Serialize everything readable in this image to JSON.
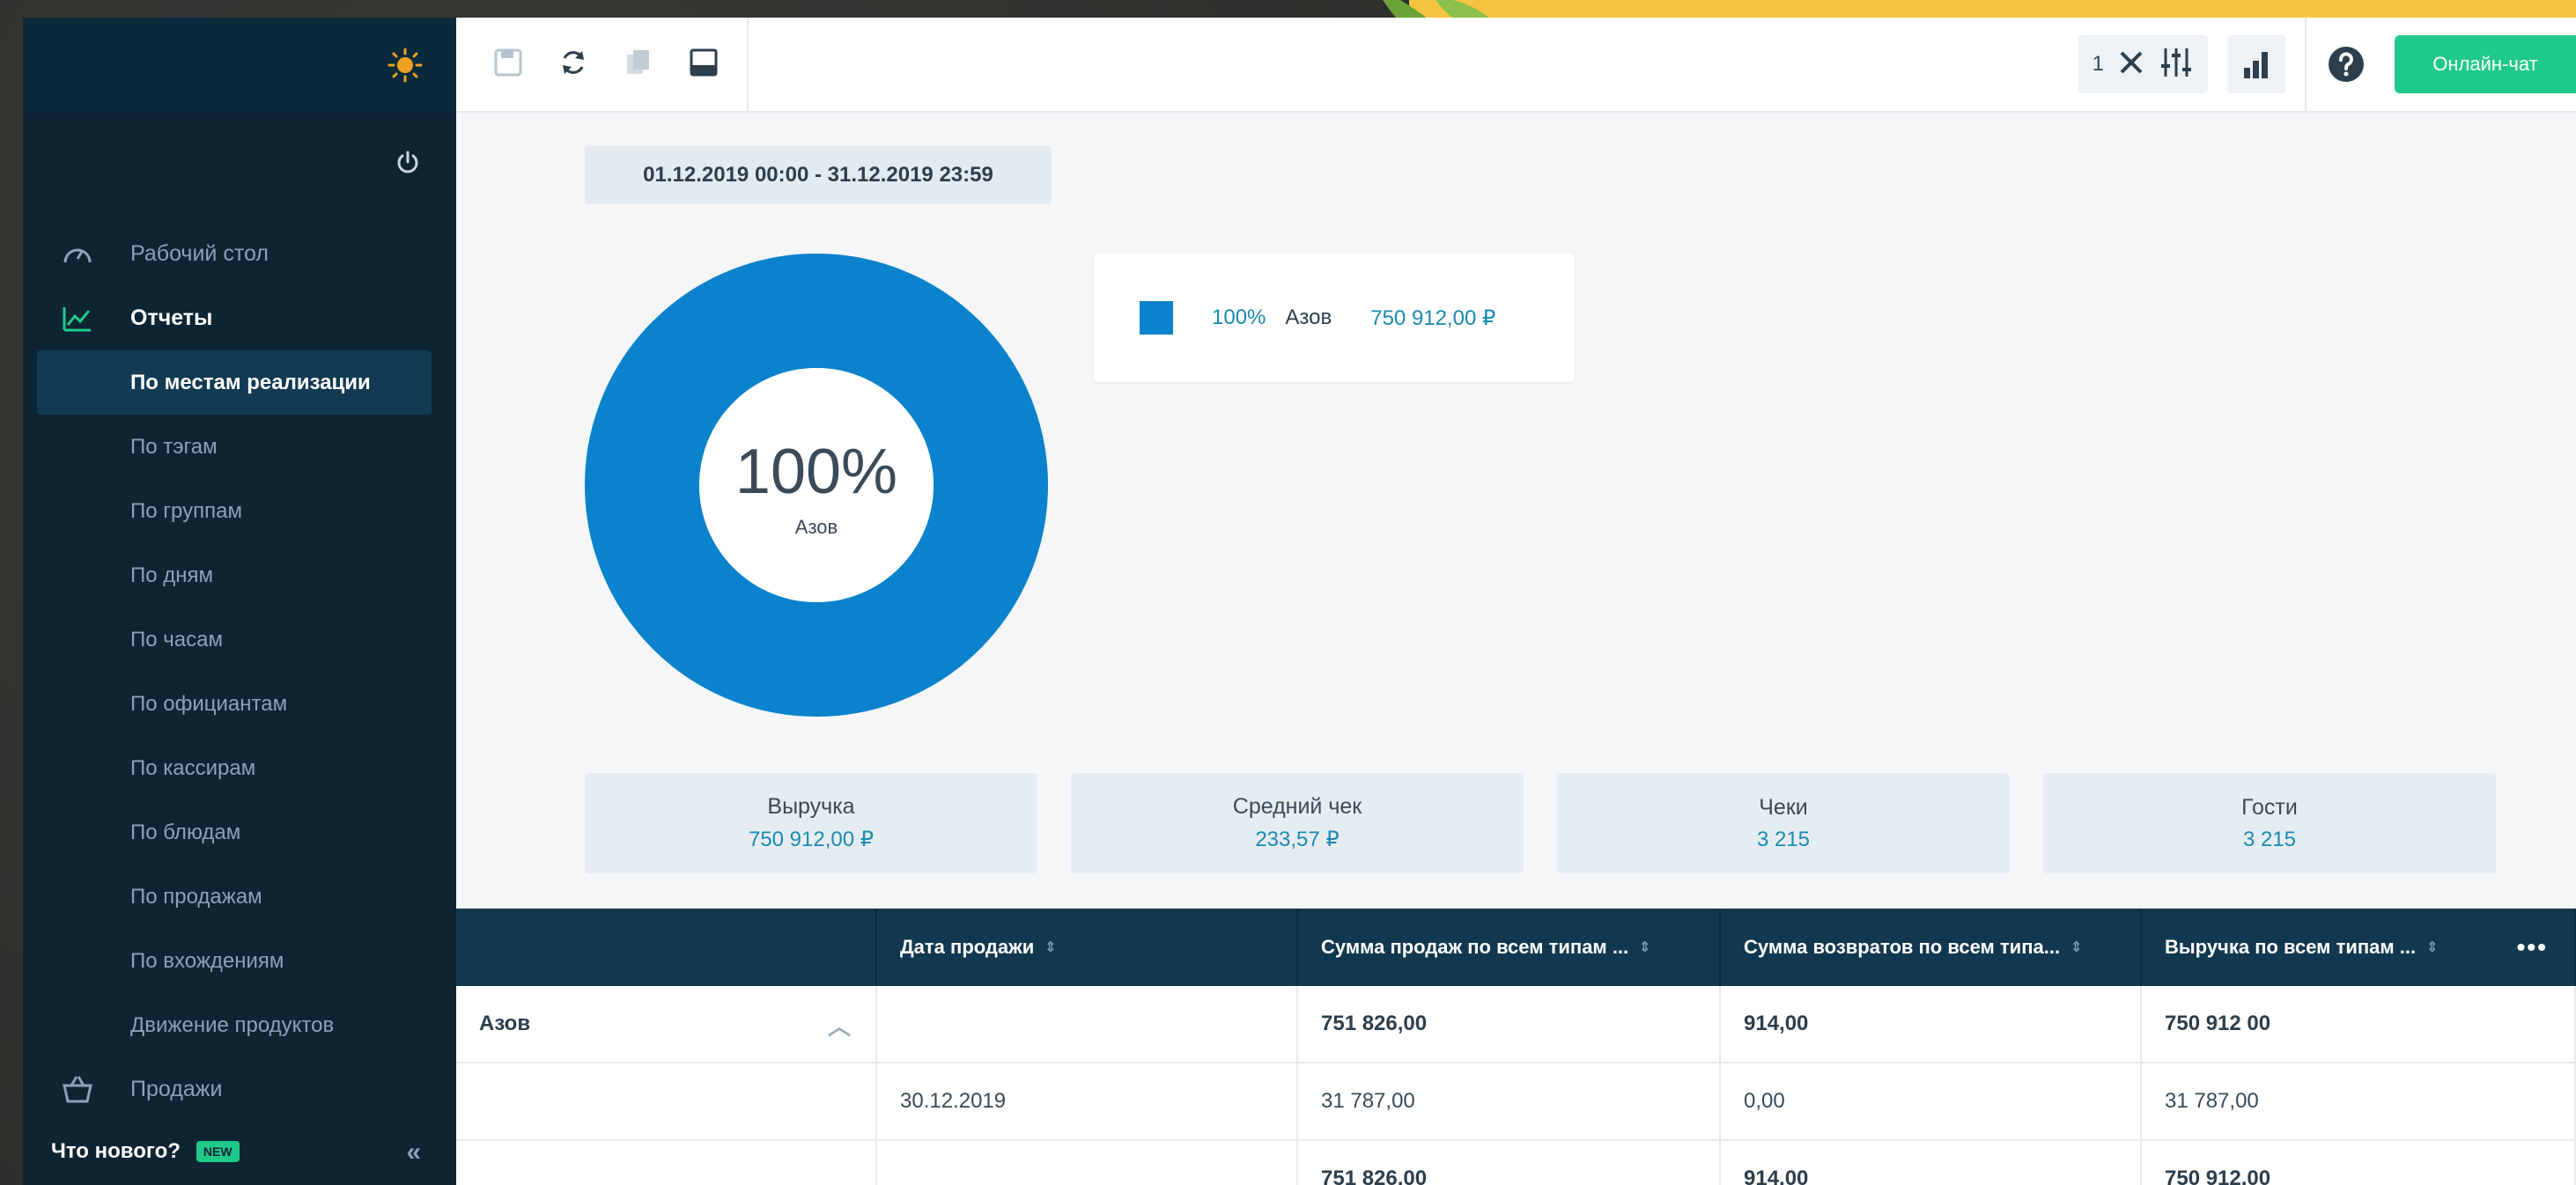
{
  "sidebar": {
    "nav": [
      {
        "label": "Рабочий стол",
        "icon": "speedometer-icon"
      },
      {
        "label": "Отчеты",
        "icon": "chart-up-icon"
      }
    ],
    "sub_items": [
      "По местам реализации",
      "По тэгам",
      "По группам",
      "По дням",
      "По часам",
      "По официантам",
      "По кассирам",
      "По блюдам",
      "По продажам",
      "По вхождениям",
      "Движение продуктов"
    ],
    "sales": {
      "label": "Продажи",
      "icon": "basket-icon"
    },
    "whats_new": "Что нового?",
    "new_badge": "NEW",
    "collapse": "«"
  },
  "toolbar": {
    "filter_count": "1",
    "chat_label": "Онлайн-чат"
  },
  "date_range": "01.12.2019 00:00 - 31.12.2019 23:59",
  "donut": {
    "center_value": "100%",
    "center_label": "Азов"
  },
  "legend": {
    "percent": "100%",
    "name": "Азов",
    "value": "750 912,00 ₽"
  },
  "stats": [
    {
      "label": "Выручка",
      "value": "750 912,00 ₽"
    },
    {
      "label": "Средний чек",
      "value": "233,57 ₽"
    },
    {
      "label": "Чеки",
      "value": "3 215"
    },
    {
      "label": "Гости",
      "value": "3 215"
    }
  ],
  "table": {
    "headers": [
      "",
      "Дата продажи",
      "Сумма продаж по всем типам ...",
      "Сумма возвратов по всем типа...",
      "Выручка по всем типам ..."
    ],
    "group_row": [
      "Азов",
      "",
      "751 826,00",
      "914,00",
      "750 912 00"
    ],
    "detail_row": [
      "",
      "30.12.2019",
      "31 787,00",
      "0,00",
      "31 787,00"
    ],
    "total_row": [
      "",
      "",
      "751 826,00",
      "914,00",
      "750 912,00"
    ],
    "more": "•••"
  },
  "colors": {
    "sidebar": "#0d2433",
    "accent": "#0a82cc",
    "green": "#1fc98a",
    "table_header": "#12384f"
  }
}
